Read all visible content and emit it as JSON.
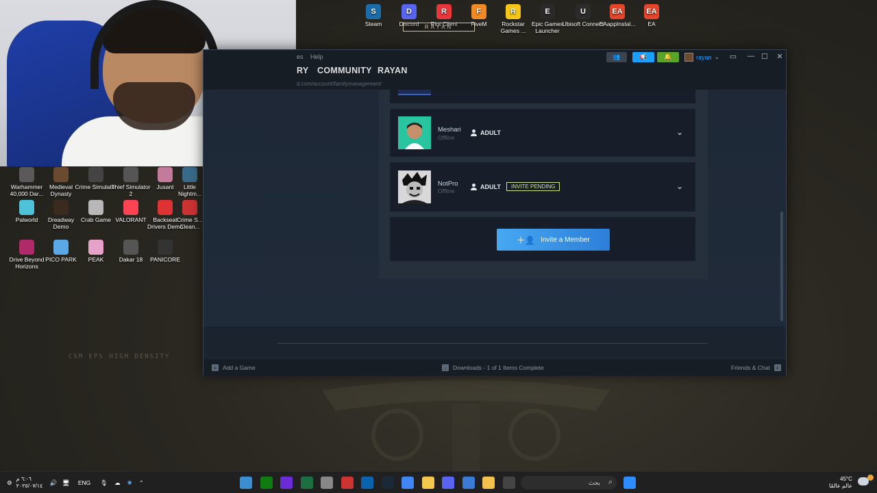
{
  "wallpaper": {
    "text": "CSM EPS HIGH DENSITY"
  },
  "webcam": {
    "label": "RAYAN"
  },
  "desktop_top_icons": [
    {
      "label": "Steam",
      "color": "#1b6ca8",
      "glyph": "S"
    },
    {
      "label": "Discord",
      "color": "#5865f2",
      "glyph": "D"
    },
    {
      "label": "Riot Client",
      "color": "#e8363b",
      "glyph": "R"
    },
    {
      "label": "FiveM",
      "color": "#f08a24",
      "glyph": "F"
    },
    {
      "label": "Rockstar Games ...",
      "color": "#f5c518",
      "glyph": "R"
    },
    {
      "label": "Epic Games Launcher",
      "color": "#2a2a2a",
      "glyph": "E"
    },
    {
      "label": "Ubisoft Connect",
      "color": "#2c2c2c",
      "glyph": "U"
    },
    {
      "label": "EAappInstal...",
      "color": "#e5452a",
      "glyph": "EA"
    },
    {
      "label": "EA",
      "color": "#e5452a",
      "glyph": "EA"
    }
  ],
  "desktop_left_icons": [
    {
      "label": "Warhammer 40,000 Dar...",
      "color": "#5a5a5a"
    },
    {
      "label": "Medieval Dynasty",
      "color": "#6b4a2f"
    },
    {
      "label": "Crime Simulator",
      "color": "#444"
    },
    {
      "label": "Thief Simulator 2",
      "color": "#555"
    },
    {
      "label": "Jusant",
      "color": "#c47a9a"
    },
    {
      "label": "Little Nightm...",
      "color": "#3a6b8a"
    },
    {
      "label": "Palworld",
      "color": "#4fc1d9"
    },
    {
      "label": "Dreadway Demo",
      "color": "#3b2b1e"
    },
    {
      "label": "Crab Game",
      "color": "#b8b8b8"
    },
    {
      "label": "VALORANT",
      "color": "#fa4454"
    },
    {
      "label": "Backseat Drivers Demo",
      "color": "#d33"
    },
    {
      "label": "Crime S... Clean...",
      "color": "#c33"
    },
    {
      "label": "Drive Beyond Horizons",
      "color": "#b02a6a"
    },
    {
      "label": "PICO PARK",
      "color": "#5aa9e6"
    },
    {
      "label": "PEAK",
      "color": "#e7a2c9"
    },
    {
      "label": "Dakar 18",
      "color": "#555"
    },
    {
      "label": "PANICORE",
      "color": "#333"
    }
  ],
  "steam": {
    "menu": {
      "partial": "es",
      "help": "Help"
    },
    "titlebar": {
      "username": "rayan"
    },
    "nav": {
      "library_partial": "RY",
      "community": "COMMUNITY",
      "profile": "RAYAN"
    },
    "url": "d.com/account/familymanagement/",
    "members": [
      {
        "name": "Meshari",
        "status": "Offline",
        "role": "ADULT",
        "avatar_color": "#29c4a0"
      },
      {
        "name": "NotPro",
        "status": "Offline",
        "role": "ADULT",
        "badge": "INVITE PENDING",
        "avatar_color": "#d8d8d8"
      }
    ],
    "invite_button": "Invite a Member",
    "bottom": {
      "add_game": "Add a Game",
      "downloads": "Downloads - 1 of 1 Items Complete",
      "friends": "Friends & Chat"
    }
  },
  "taskbar": {
    "lang": "ENG",
    "time": "٦:٠٦ م",
    "date": "٢٠٢٥/٠٧/١٤",
    "search_placeholder": "بحث",
    "weather_temp": "45°C",
    "weather_label": "عالم عالمًا",
    "apps": [
      {
        "name": "explorer-widget",
        "color": "#3b8ed0"
      },
      {
        "name": "xbox",
        "color": "#107c10"
      },
      {
        "name": "nzxt",
        "color": "#6c2bd9"
      },
      {
        "name": "excel-like",
        "color": "#1d6f42"
      },
      {
        "name": "settings",
        "color": "#888"
      },
      {
        "name": "recorder",
        "color": "#c33"
      },
      {
        "name": "outlook",
        "color": "#0a64ad"
      },
      {
        "name": "steam",
        "color": "#1b2838"
      },
      {
        "name": "chrome",
        "color": "#4285f4"
      },
      {
        "name": "app-yellow",
        "color": "#f2c94c"
      },
      {
        "name": "discord",
        "color": "#5865f2"
      },
      {
        "name": "store",
        "color": "#3a7bd5"
      },
      {
        "name": "folder",
        "color": "#f2c14e"
      },
      {
        "name": "terminal",
        "color": "#444"
      }
    ]
  }
}
